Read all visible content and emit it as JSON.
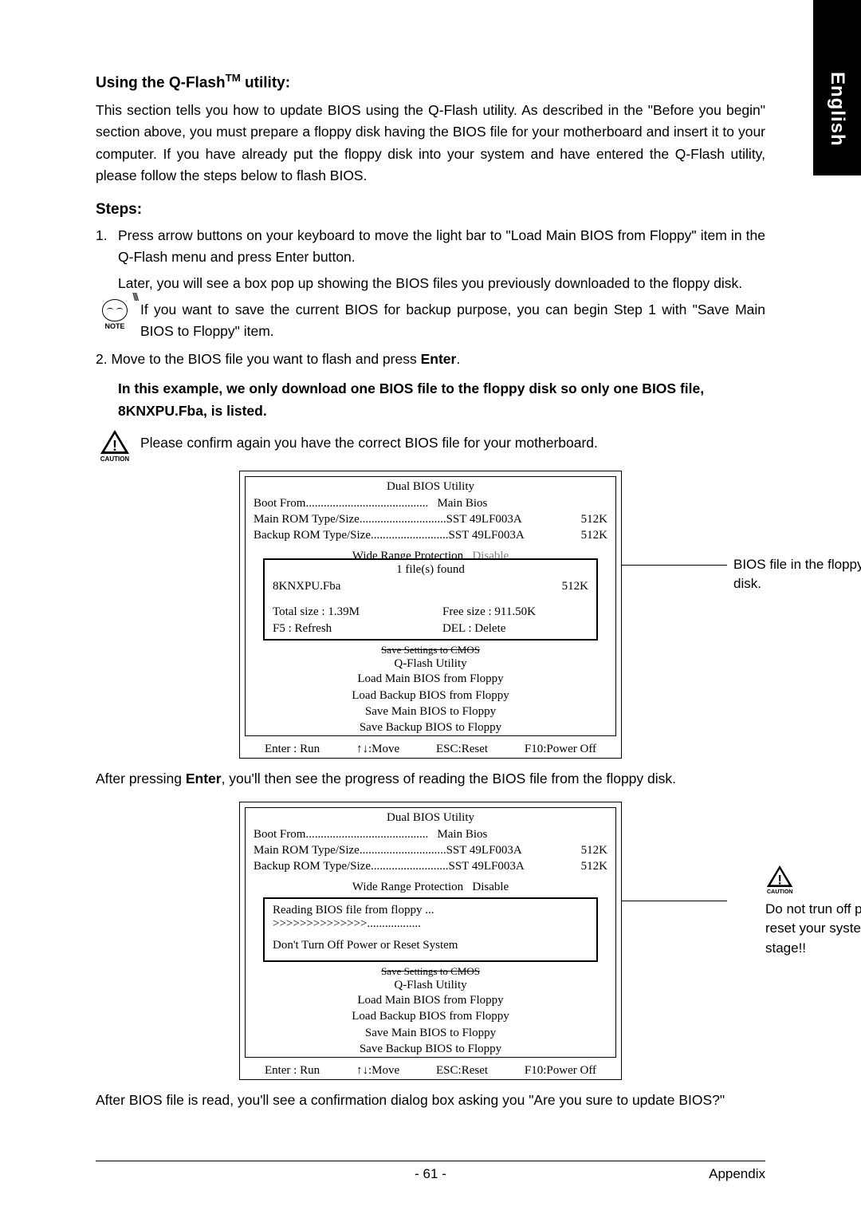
{
  "lang_tab": "English",
  "heading1_pre": "Using the Q-Flash",
  "heading1_tm": "TM",
  "heading1_post": " utility:",
  "intro": "This section tells you how to update BIOS using the Q-Flash utility. As described in the \"Before you begin\" section above, you must prepare a floppy disk having the BIOS file for your motherboard and insert it to your computer. If you have already put the floppy disk into your system and have entered the Q-Flash utility, please follow the steps below to flash BIOS.",
  "steps_heading": "Steps:",
  "step1_num": "1.",
  "step1a": "Press arrow buttons on your keyboard to move the light bar to \"Load Main BIOS from Floppy\" item in the Q-Flash menu and press Enter button.",
  "step1b": "Later, you will see a box pop up showing the BIOS files you previously downloaded to the floppy disk.",
  "note_label": "NOTE",
  "note_text": "If you want to save the current BIOS for backup purpose, you can begin Step 1 with \"Save Main BIOS to Floppy\" item.",
  "step2_pre": "2. Move to the BIOS file you want to flash and press ",
  "step2_bold": "Enter",
  "step2_post": ".",
  "bold_block": "In this example, we only download one BIOS file to the floppy disk so only one BIOS file, 8KNXPU.Fba, is listed.",
  "caution_label": "CAUTION",
  "caution_text": "Please confirm again you have the correct BIOS file for your motherboard.",
  "bios1": {
    "title": "Dual BIOS Utility",
    "boot_from_label": "Boot From",
    "boot_from_value": "Main Bios",
    "main_rom_label": "Main ROM Type/Size",
    "main_rom_value": "SST 49LF003A",
    "main_rom_size": "512K",
    "backup_rom_label": "Backup ROM Type/Size",
    "backup_rom_value": "SST 49LF003A",
    "backup_rom_size": "512K",
    "wide_range_label": "Wide Range Protection",
    "wide_range_value": "Disable",
    "popup_title": "1 file(s) found",
    "file_name": "8KNXPU.Fba",
    "file_size": "512K",
    "total_size_label": "Total size : 1.39M",
    "free_size_label": "Free size : 911.50K",
    "f5": "F5 : Refresh",
    "del": "DEL : Delete",
    "strike": "Save Settings to CMOS",
    "qflash": "Q-Flash Utility",
    "menu": [
      "Load Main BIOS from Floppy",
      "Load Backup BIOS from Floppy",
      "Save Main BIOS to Floppy",
      "Save Backup BIOS to Floppy"
    ],
    "footer": [
      "Enter : Run",
      "↑↓:Move",
      "ESC:Reset",
      "F10:Power Off"
    ]
  },
  "annot1": "BIOS file in the floppy disk.",
  "after1_pre": "After pressing ",
  "after1_bold": "Enter",
  "after1_post": ", you'll then see the progress of reading the BIOS file from the floppy disk.",
  "bios2": {
    "reading": "Reading BIOS file from floppy ...",
    "progress": ">>>>>>>>>>>>>>..................",
    "warning": "Don't Turn Off Power or Reset System"
  },
  "annot2": "Do not trun off power or reset your system at this stage!!",
  "after2": "After BIOS file is read, you'll see a confirmation dialog box asking you \"Are you sure to update BIOS?\"",
  "page_num": "- 61 -",
  "appendix": "Appendix"
}
